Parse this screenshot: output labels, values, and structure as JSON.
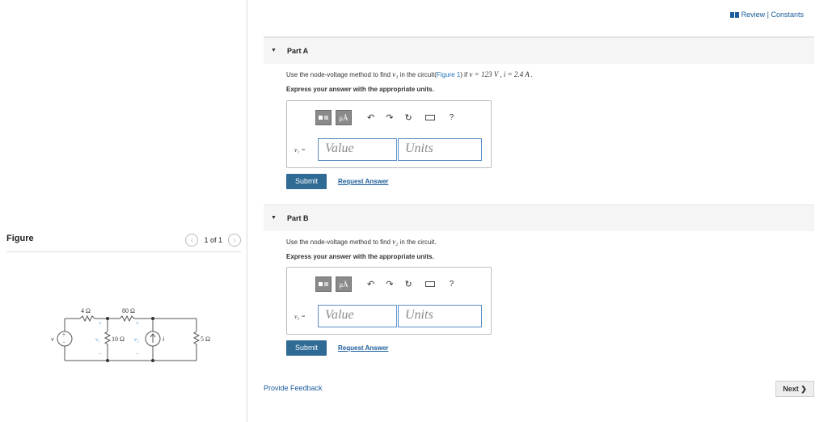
{
  "header": {
    "review_constants": "Review | Constants"
  },
  "figure": {
    "title": "Figure",
    "pager_text": "1 of 1",
    "circuit": {
      "source_label": "v",
      "r1": "4 Ω",
      "r2": "80 Ω",
      "r3": "10 Ω",
      "r4": "5 Ω",
      "node1": "v₁",
      "node2": "v₂",
      "current": "i",
      "plus": "+",
      "minus": "−"
    }
  },
  "part_a": {
    "title": "Part A",
    "prompt_pre": "Use the node-voltage method to find ",
    "prompt_var": "v₁",
    "prompt_mid": " in the circuit(",
    "prompt_link": "Figure 1",
    "prompt_post": ") if ",
    "prompt_cond": "v = 123 V , i = 2.4 A .",
    "instruction": "Express your answer with the appropriate units.",
    "answer_label": "v₁ =",
    "value_placeholder": "Value",
    "units_placeholder": "Units",
    "submit": "Submit",
    "request": "Request Answer"
  },
  "part_b": {
    "title": "Part B",
    "prompt_pre": "Use the node-voltage method to find ",
    "prompt_var": "v₂",
    "prompt_post": " in the circuit.",
    "instruction": "Express your answer with the appropriate units.",
    "answer_label": "v₂ =",
    "value_placeholder": "Value",
    "units_placeholder": "Units",
    "submit": "Submit",
    "request": "Request Answer"
  },
  "toolbar": {
    "mu_a": "μÅ",
    "help": "?"
  },
  "footer": {
    "feedback": "Provide Feedback",
    "next": "Next ❯"
  }
}
